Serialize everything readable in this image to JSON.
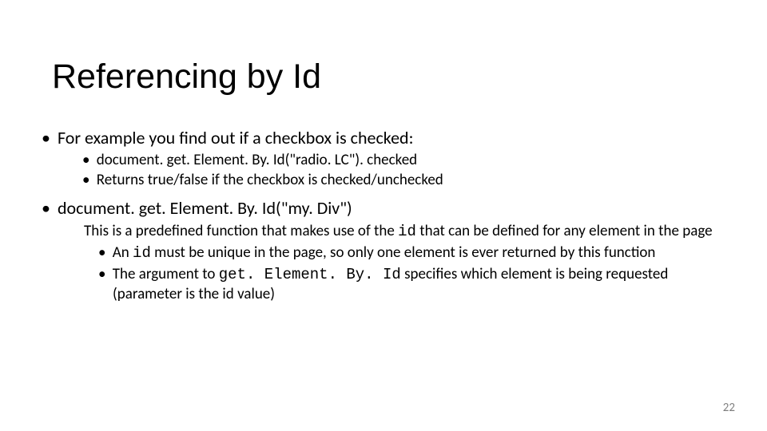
{
  "title": "Referencing by Id",
  "bullets": {
    "l1a": "For example you find out if a checkbox is checked:",
    "l2a": "document. get. Element. By. Id(\"radio. LC\"). checked",
    "l2b": "Returns true/false if the checkbox is checked/unchecked",
    "l1b": "document. get. Element. By. Id(\"my. Div\")",
    "l3intro_a": "This is a predefined function that makes use of the ",
    "l3intro_code": "id",
    "l3intro_b": " that can be defined for any element in the page",
    "l3a_a": "An ",
    "l3a_code": "id",
    "l3a_b": " must be unique in the page, so only one element is ever returned by this function",
    "l3b_a": "The argument to ",
    "l3b_code": "get. Element. By. Id",
    "l3b_b": " specifies which element is being requested (parameter is the id value)"
  },
  "page_number": "22"
}
